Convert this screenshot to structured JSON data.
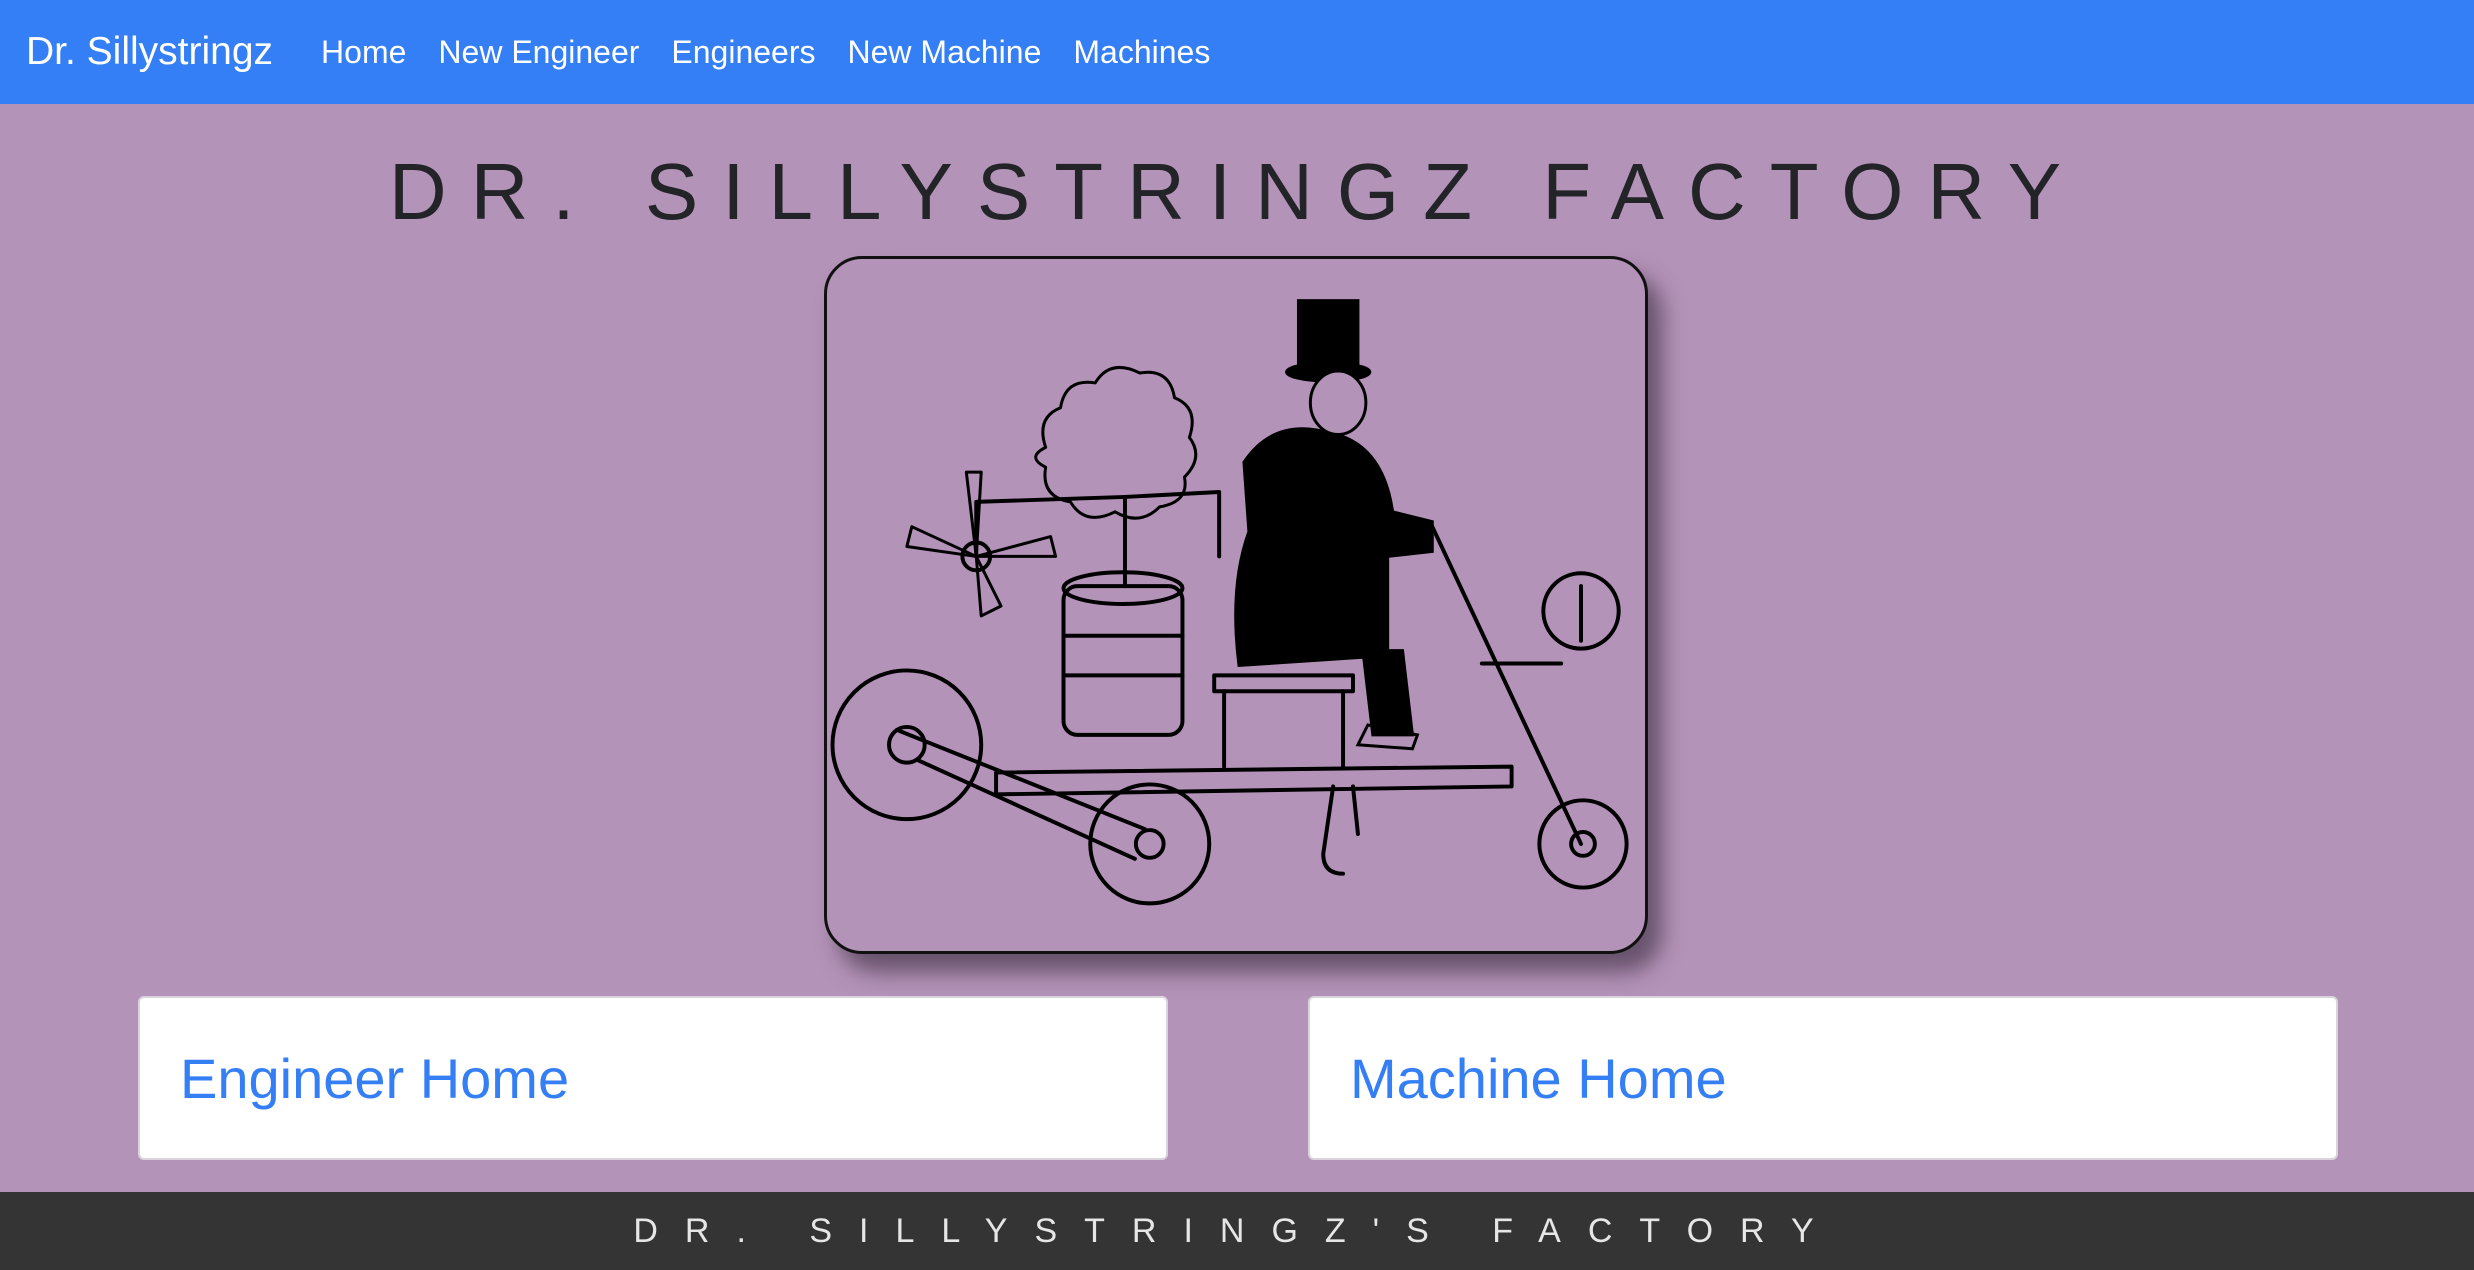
{
  "navbar": {
    "brand": "Dr. Sillystringz",
    "links": [
      "Home",
      "New Engineer",
      "Engineers",
      "New Machine",
      "Machines"
    ]
  },
  "main": {
    "title": "DR. SILLYSTRINGZ FACTORY",
    "cards": [
      {
        "label": "Engineer Home"
      },
      {
        "label": "Machine Home"
      }
    ]
  },
  "footer": {
    "text": "DR. SILLYSTRINGZ'S FACTORY"
  },
  "colors": {
    "navbar": "#347ef6",
    "background": "#b493b8",
    "footer": "#343434",
    "link": "#347ef6"
  }
}
